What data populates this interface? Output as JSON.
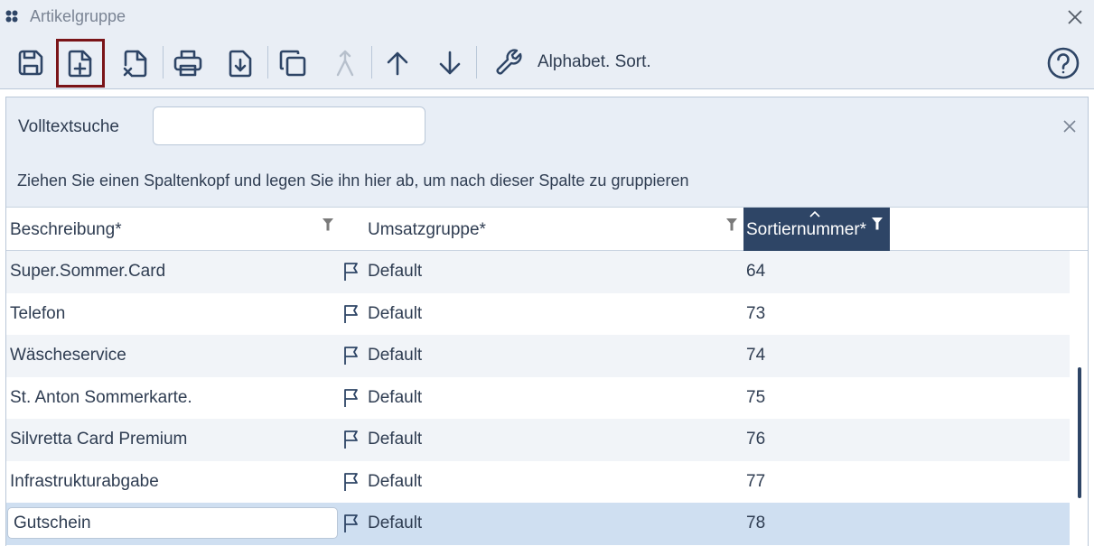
{
  "window": {
    "title": "Artikelgruppe"
  },
  "toolbar": {
    "buttons": [
      {
        "name": "save",
        "icon": "save-icon"
      },
      {
        "name": "new",
        "icon": "new-document-icon"
      },
      {
        "name": "delete",
        "icon": "delete-document-icon"
      },
      {
        "name": "print",
        "icon": "printer-icon"
      },
      {
        "name": "export",
        "icon": "download-icon"
      },
      {
        "name": "copy",
        "icon": "copy-icon"
      },
      {
        "name": "merge",
        "icon": "merge-icon"
      },
      {
        "name": "move-up",
        "icon": "arrow-up-icon"
      },
      {
        "name": "move-down",
        "icon": "arrow-down-icon"
      },
      {
        "name": "tools",
        "icon": "wrench-icon"
      }
    ],
    "alpha_sort_label": "Alphabet. Sort."
  },
  "search": {
    "label": "Volltextsuche",
    "value": "",
    "group_hint": "Ziehen Sie einen Spaltenkopf und legen Sie ihn hier ab, um nach dieser Spalte zu gruppieren"
  },
  "grid": {
    "columns": [
      {
        "label": "Beschreibung*"
      },
      {
        "label": "Umsatzgruppe*"
      },
      {
        "label": "Sortiernummer*"
      }
    ],
    "rows": [
      {
        "beschreibung": "Super.Sommer.Card",
        "umsatzgruppe": "Default",
        "sortiernummer": "64"
      },
      {
        "beschreibung": "Telefon",
        "umsatzgruppe": "Default",
        "sortiernummer": "73"
      },
      {
        "beschreibung": "Wäscheservice",
        "umsatzgruppe": "Default",
        "sortiernummer": "74"
      },
      {
        "beschreibung": "St. Anton Sommerkarte.",
        "umsatzgruppe": "Default",
        "sortiernummer": "75"
      },
      {
        "beschreibung": "Silvretta Card Premium",
        "umsatzgruppe": "Default",
        "sortiernummer": "76"
      },
      {
        "beschreibung": "Infrastrukturabgabe",
        "umsatzgruppe": "Default",
        "sortiernummer": "77"
      },
      {
        "beschreibung": "Gutschein",
        "umsatzgruppe": "Default",
        "sortiernummer": "78"
      }
    ]
  },
  "colors": {
    "accent": "#2e4566",
    "active_outline": "#7a1418",
    "selected_row": "#cfdff1",
    "panel": "#e8eef6"
  }
}
